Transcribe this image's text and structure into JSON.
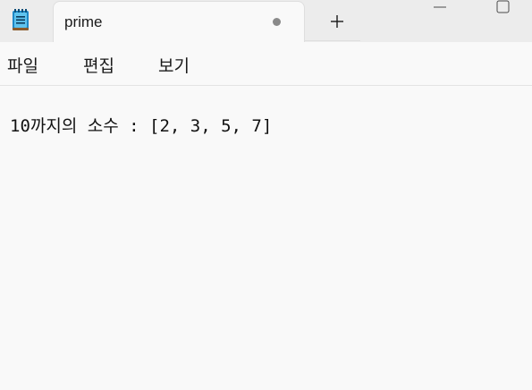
{
  "tab": {
    "title": "prime",
    "modified": true
  },
  "menu": {
    "items": [
      "파일",
      "편집",
      "보기"
    ]
  },
  "editor": {
    "content": "10까지의 소수 : [2, 3, 5, 7]"
  },
  "icons": {
    "app": "notepad-icon",
    "modified": "unsaved-dot-icon",
    "new_tab": "plus-icon",
    "minimize": "minimize-icon",
    "maximize": "maximize-icon"
  }
}
